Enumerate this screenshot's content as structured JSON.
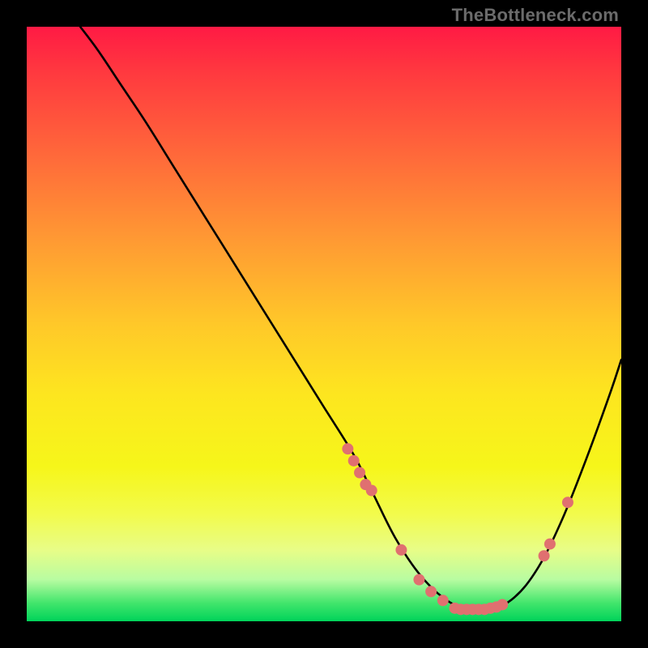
{
  "attribution": "TheBottleneck.com",
  "chart_data": {
    "type": "line",
    "title": "",
    "xlabel": "",
    "ylabel": "",
    "xlim": [
      0,
      100
    ],
    "ylim": [
      0,
      100
    ],
    "series": [
      {
        "name": "bottleneck-curve",
        "x": [
          9,
          12,
          16,
          20,
          25,
          30,
          35,
          40,
          45,
          50,
          55,
          58,
          62,
          66,
          70,
          74,
          78,
          82,
          86,
          90,
          94,
          98,
          100
        ],
        "y": [
          100,
          96,
          90,
          84,
          76,
          68,
          60,
          52,
          44,
          36,
          28,
          22,
          14,
          8,
          4,
          2,
          2,
          4,
          9,
          17,
          27,
          38,
          44
        ]
      },
      {
        "name": "marker-dots",
        "type": "scatter",
        "x": [
          54,
          55,
          56,
          57,
          58,
          63,
          66,
          68,
          70,
          72,
          73,
          74,
          75,
          76,
          77,
          78,
          79,
          80,
          87,
          88,
          91
        ],
        "y": [
          29,
          27,
          25,
          23,
          22,
          12,
          7,
          5,
          3.5,
          2.2,
          2,
          2,
          2,
          2,
          2,
          2.2,
          2.4,
          2.8,
          11,
          13,
          20
        ]
      }
    ],
    "colors": {
      "curve": "#000000",
      "dots": "#e07070"
    }
  }
}
